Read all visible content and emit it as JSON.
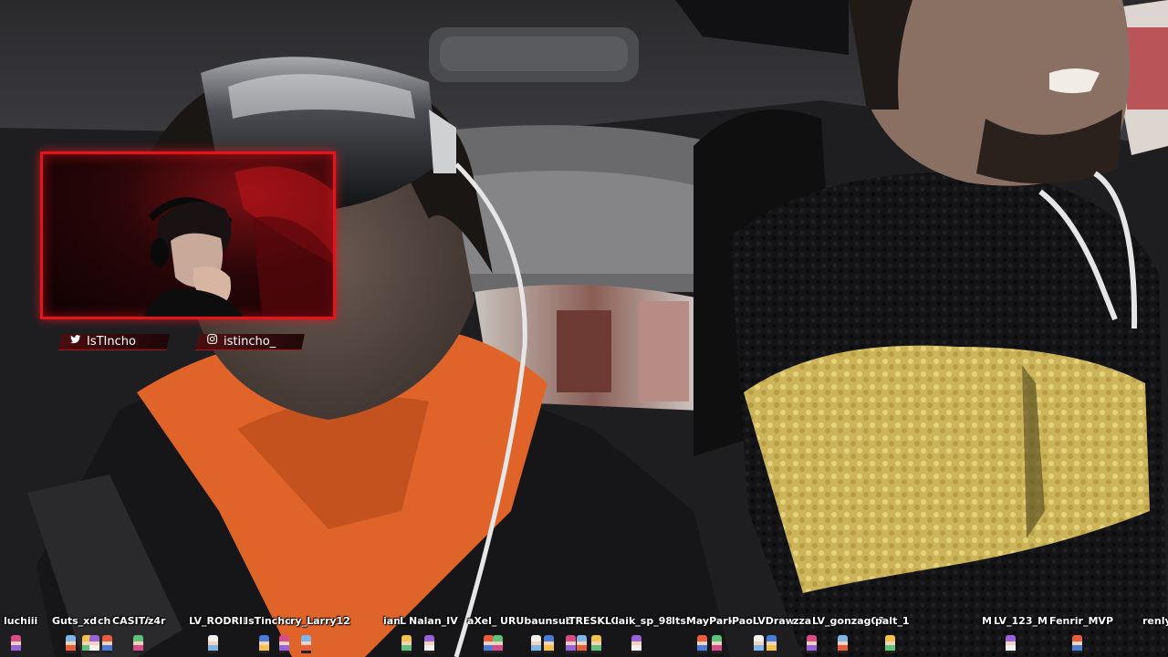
{
  "stream": {
    "social": {
      "twitter_handle": "IsTIncho",
      "instagram_handle": "istincho_"
    },
    "usernames": [
      "luchiii",
      "Guts_xd",
      "ch",
      "CASITA",
      "z4r",
      "LV_RODRII",
      "IsTincho",
      "ry_Larry12",
      "ian",
      "L",
      "Nalan_IV",
      "aXel_",
      "URUbaunsub",
      "TRESKLO",
      "laik_sp_98",
      "ItsMayPark",
      "PaoLVDraw",
      "zza",
      "LV_gonzag03",
      "palt_1",
      "M",
      "LV_123_M",
      "Fenrir_MVP",
      "renly"
    ],
    "colors": {
      "frame_red": "#e3141b",
      "hoodie_orange": "#e0642a",
      "jacket_yellow": "#d9c25a",
      "jacket_black": "#131314"
    }
  }
}
